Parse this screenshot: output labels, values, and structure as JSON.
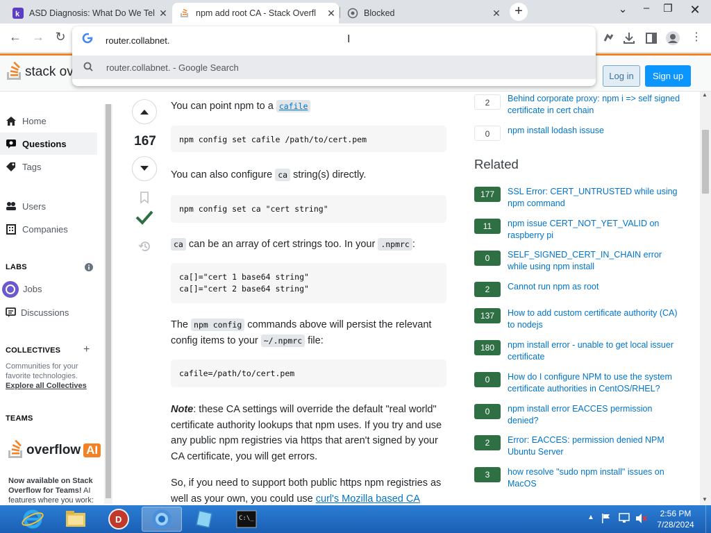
{
  "browser": {
    "tabs": [
      {
        "title": "ASD Diagnosis: What Do We Tel",
        "favicon": "k-icon",
        "active": false
      },
      {
        "title": "npm add root CA - Stack Overfl",
        "favicon": "stackoverflow-icon",
        "active": true
      },
      {
        "title": "Blocked",
        "favicon": "globe-icon",
        "active": false
      }
    ],
    "omnibox": {
      "value": "router.collabnet.",
      "suggestion": "router.collabnet. - Google Search"
    }
  },
  "so": {
    "logo_text": "stack ove",
    "login_label": "Log in",
    "signup_label": "Sign up"
  },
  "sidebar": {
    "items": [
      {
        "label": "Home",
        "icon": "home-icon"
      },
      {
        "label": "Questions",
        "icon": "questions-icon"
      },
      {
        "label": "Tags",
        "icon": "tag-icon"
      },
      {
        "label": "Users",
        "icon": "users-icon"
      },
      {
        "label": "Companies",
        "icon": "companies-icon"
      },
      {
        "label": "Jobs",
        "icon": "jobs-icon"
      },
      {
        "label": "Discussions",
        "icon": "discussions-icon"
      }
    ],
    "labs_heading": "LABS",
    "collectives_heading": "COLLECTIVES",
    "collectives_text": "Communities for your favorite technologies.",
    "collectives_link": "Explore all Collectives",
    "teams_heading": "TEAMS",
    "overflow_ai_text": "overflow",
    "overflow_ai_badge": "AI",
    "promo_bold": "Now available on Stack Overflow for Teams!",
    "promo_text": " AI features where you work:"
  },
  "answer": {
    "vote_count": "167",
    "p1_pre": "You can point npm to a ",
    "p1_code": "cafile",
    "code1": "npm config set cafile /path/to/cert.pem",
    "p2_pre": "You can also configure ",
    "p2_code": "ca",
    "p2_post": " string(s) directly.",
    "code2": "npm config set ca \"cert string\"",
    "p3_code1": "ca",
    "p3_mid": " can be an array of cert strings too. In your ",
    "p3_code2": ".npmrc",
    "p3_post": ":",
    "code3": "ca[]=\"cert 1 base64 string\"\nca[]=\"cert 2 base64 string\"",
    "p4_pre": "The ",
    "p4_code1": "npm config",
    "p4_mid": " commands above will persist the relevant config items to your ",
    "p4_code2": "~/.npmrc",
    "p4_post": " file:",
    "code4": "cafile=/path/to/cert.pem",
    "p5_bold": "Note",
    "p5_text": ": these CA settings will override the default \"real world\" certificate authority lookups that npm uses. If you try and use any public npm registries via https that aren't signed by your CA certificate, you will get errors.",
    "p6_pre": "So, if you need to support both public https npm registries as well as your own, you could use ",
    "p6_link": "curl's Mozilla based CA"
  },
  "linked": [
    {
      "count": "2",
      "title": "Behind corporate proxy: npm i => self signed certificate in cert chain"
    },
    {
      "count": "0",
      "title": "npm install lodash issuse"
    }
  ],
  "related_heading": "Related",
  "related": [
    {
      "count": "177",
      "title": "SSL Error: CERT_UNTRUSTED while using npm command"
    },
    {
      "count": "11",
      "title": "npm issue CERT_NOT_YET_VALID on raspberry pi"
    },
    {
      "count": "0",
      "title": "SELF_SIGNED_CERT_IN_CHAIN error while using npm install"
    },
    {
      "count": "2",
      "title": "Cannot run npm as root"
    },
    {
      "count": "137",
      "title": "How to add custom certificate authority (CA) to nodejs"
    },
    {
      "count": "180",
      "title": "npm install error - unable to get local issuer certificate"
    },
    {
      "count": "0",
      "title": "How do I configure NPM to use the system certificate authorities in CentOS/RHEL?"
    },
    {
      "count": "0",
      "title": "npm install error EACCES permission denied?"
    },
    {
      "count": "2",
      "title": "Error: EACCES: permission denied NPM Ubuntu Server"
    },
    {
      "count": "3",
      "title": "how resolve \"sudo npm install\" issues on MacOS"
    }
  ],
  "taskbar": {
    "time": "2:56 PM",
    "date": "7/28/2024"
  },
  "colors": {
    "accent_orange": "#f48225",
    "answer_green": "#2f6f44",
    "link_blue": "#0074cc",
    "signup_blue": "#0a95ff"
  }
}
